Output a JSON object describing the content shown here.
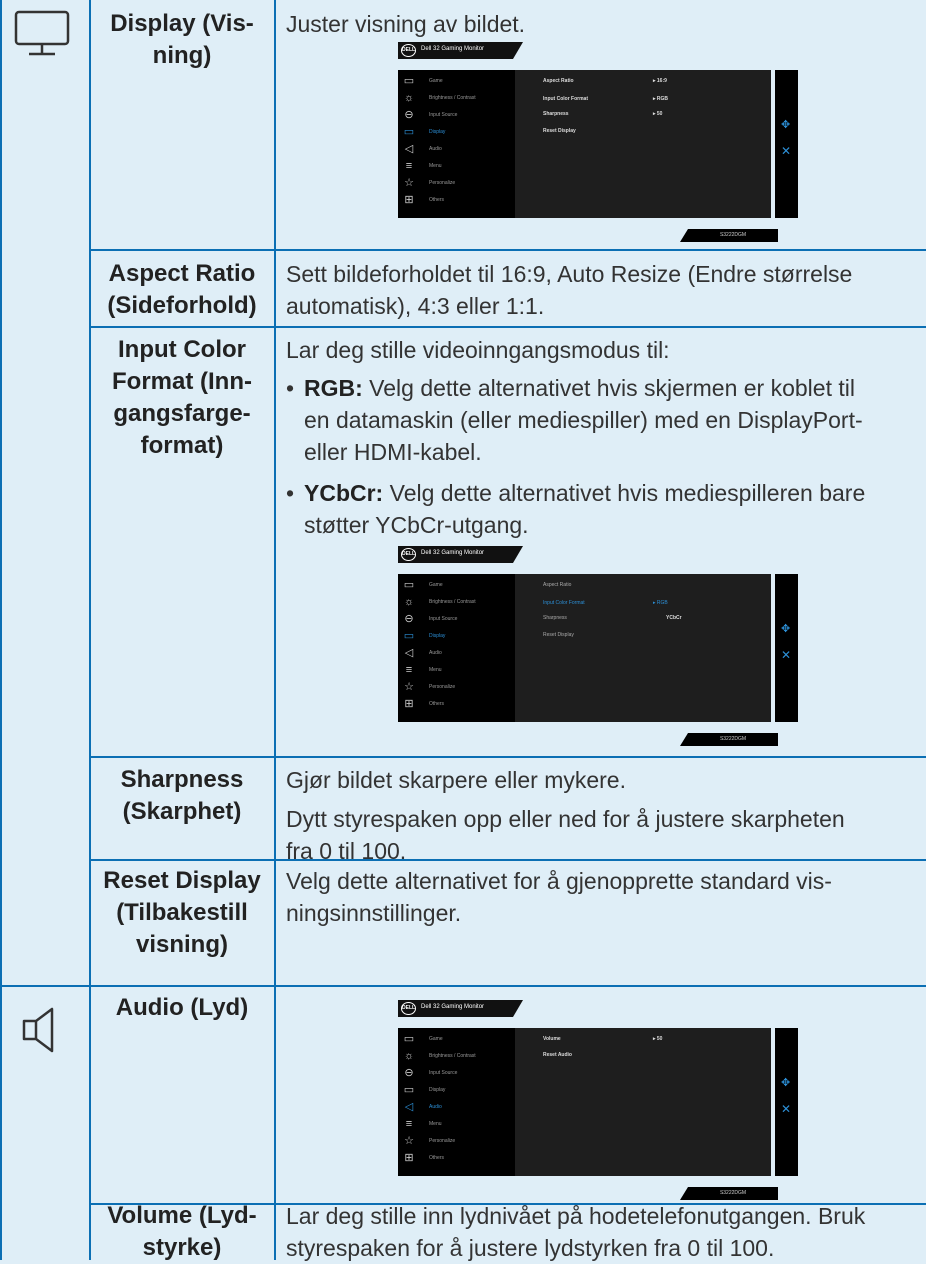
{
  "colors": {
    "accent": "#0b6fb4",
    "background": "#dfeef7",
    "osd_highlight": "#2c8fd6"
  },
  "rows": {
    "display": {
      "icon": "monitor-icon",
      "name": "Display (Vis-\nning)",
      "desc": "Juster visning av bildet."
    },
    "aspect": {
      "name": "Aspect Ratio\n(Sideforhold)",
      "desc": "Sett bildeforholdet til 16:9, Auto Resize (Endre størrelse\nautomatisk), 4:3 eller 1:1."
    },
    "input_color": {
      "name": "Input Color\nFormat (Inn-\ngangsfarge-\nformat)",
      "desc": "Lar deg stille videoinngangsmodus til:",
      "bullets": [
        {
          "label": "RGB:",
          "text": " Velg dette alternativet hvis skjermen er koblet til\nen datamaskin (eller mediespiller) med en DisplayPort-\neller HDMI-kabel."
        },
        {
          "label": "YCbCr:",
          "text": " Velg dette alternativet hvis mediespilleren bare\nstøtter YCbCr-utgang."
        }
      ]
    },
    "sharpness": {
      "name": "Sharpness\n(Skarphet)",
      "desc1": "Gjør bildet skarpere eller mykere.",
      "desc2": "Dytt styrespaken opp eller ned for å justere skarpheten\nfra 0 til 100."
    },
    "reset": {
      "name": "Reset Display\n(Tilbakestill\nvisning)",
      "desc": "Velg dette alternativet for å gjenopprette standard vis-\nningsinnstillinger."
    },
    "audio": {
      "icon": "speaker-icon",
      "name": "Audio (Lyd)"
    },
    "volume": {
      "name": "Volume (Lyd-\nstyrke)",
      "desc": "Lar deg stille inn lydnivået på hodetelefonutgangen. Bruk\nstyrespaken for å justere lydstyrken fra 0 til 100."
    }
  },
  "osd": {
    "logo": "DELL",
    "brand": "Dell 32 Gaming Monitor",
    "model": "S3222DGM",
    "menu": [
      "Game",
      "Brightness / Contrast",
      "Input Source",
      "Display",
      "Audio",
      "Menu",
      "Personalize",
      "Others"
    ],
    "menu_icons": [
      "game-icon",
      "brightness-icon",
      "input-source-icon",
      "display-icon",
      "audio-icon",
      "menu-icon",
      "personalize-icon",
      "others-icon"
    ],
    "screen1": {
      "options": [
        "Aspect Ratio",
        "Input Color Format",
        "Sharpness",
        "Reset Display"
      ],
      "values": [
        "16:9",
        "RGB",
        "50"
      ]
    },
    "screen2": {
      "options": [
        "Aspect Ratio",
        "Input Color Format",
        "Sharpness",
        "Reset Display"
      ],
      "values": [
        "RGB",
        "YCbCr"
      ]
    },
    "screen3": {
      "options": [
        "Volume",
        "Reset Audio"
      ],
      "values": [
        "50"
      ]
    }
  }
}
